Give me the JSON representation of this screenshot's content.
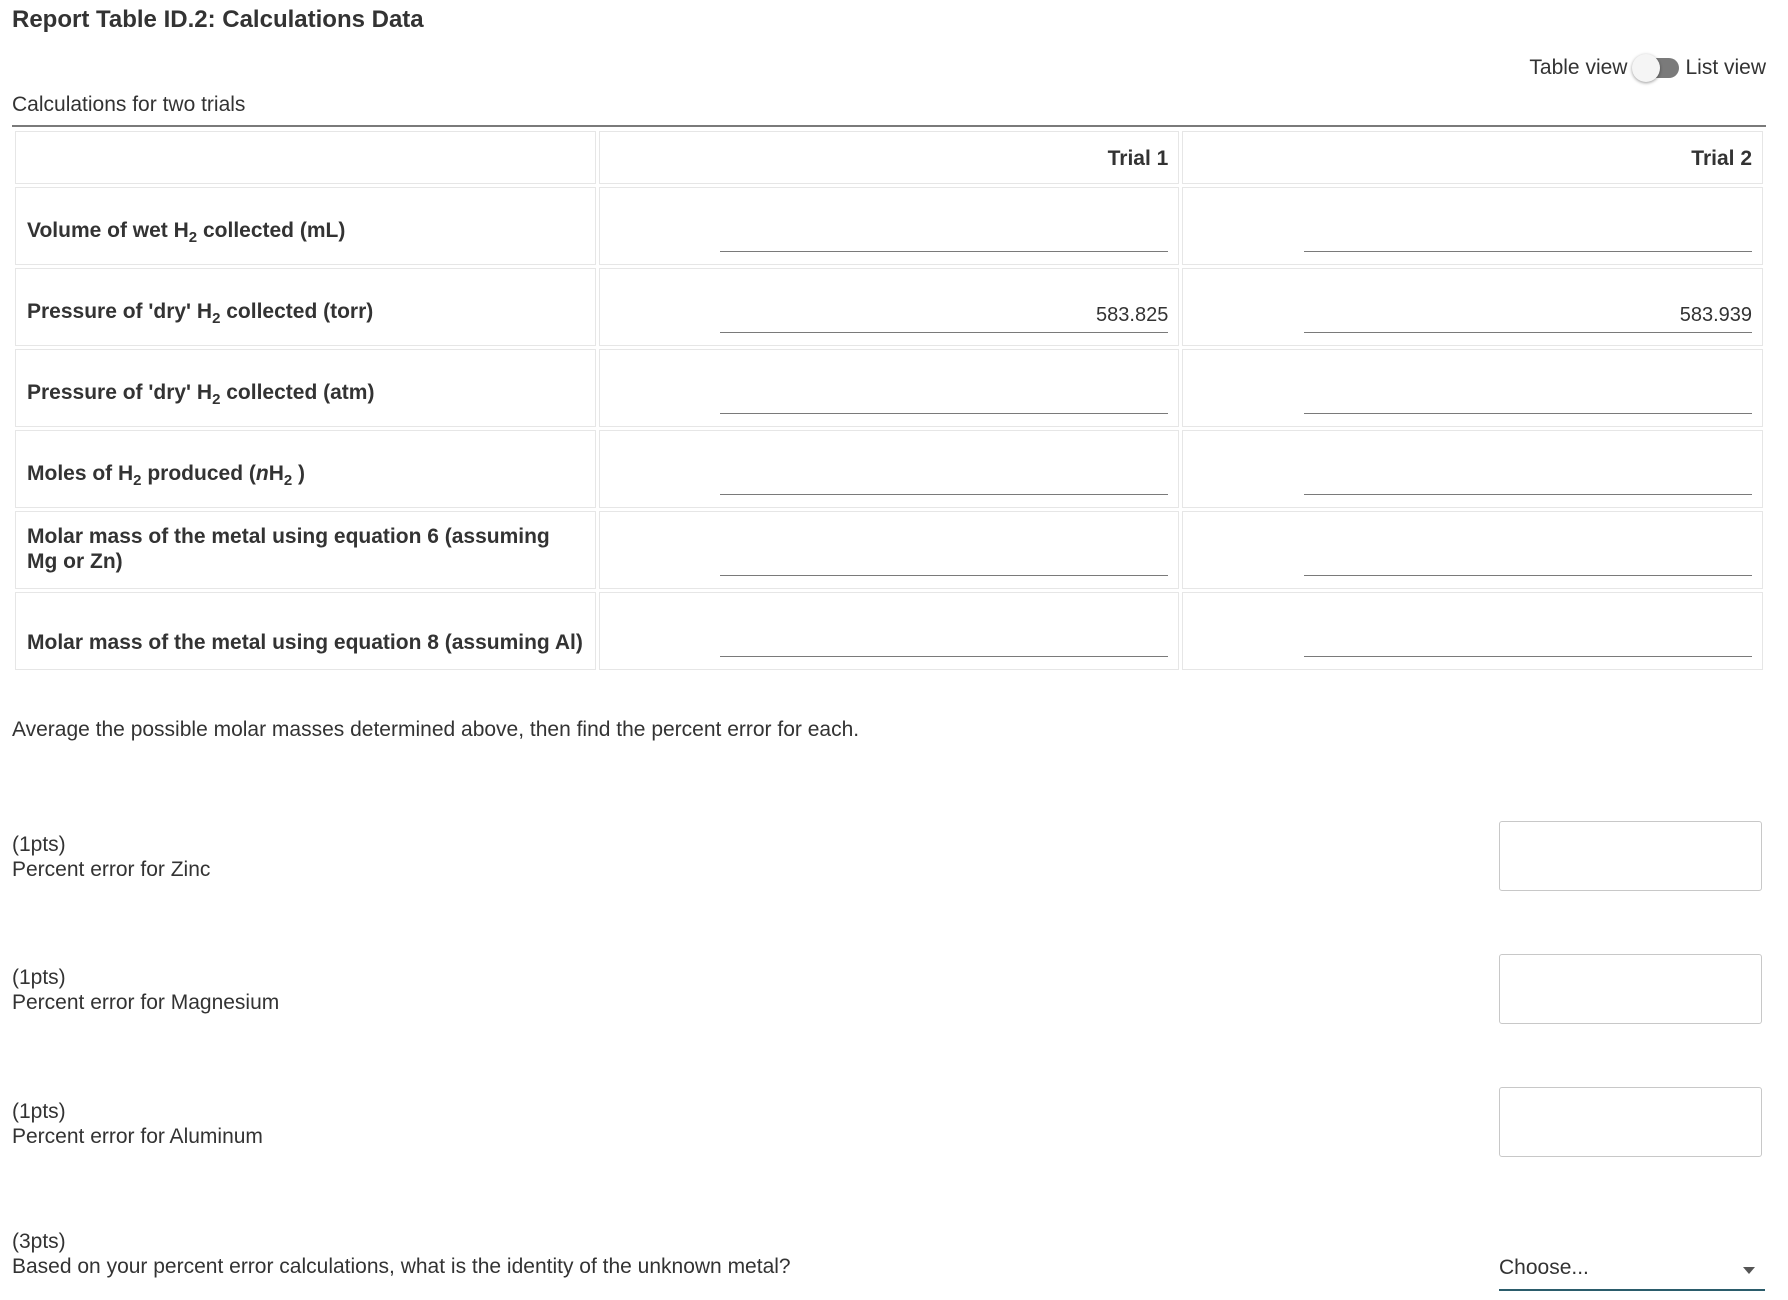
{
  "title": "Report Table ID.2: Calculations Data",
  "view_toggle": {
    "left_label": "Table view",
    "right_label": "List view"
  },
  "caption": "Calculations for two trials",
  "table": {
    "headers": [
      "Trial 1",
      "Trial 2"
    ],
    "rows": [
      {
        "label_parts": [
          "Volume of wet H",
          "2",
          " collected (mL)"
        ],
        "trial1": "",
        "trial2": ""
      },
      {
        "label_parts": [
          "Pressure of 'dry' H",
          "2",
          " collected (torr)"
        ],
        "trial1": "583.825",
        "trial2": "583.939"
      },
      {
        "label_parts": [
          "Pressure of 'dry' H",
          "2",
          " collected (atm)"
        ],
        "trial1": "",
        "trial2": ""
      },
      {
        "label_parts": [
          "Moles of H",
          "2",
          " produced (",
          "n",
          "H",
          "2",
          " )"
        ],
        "trial1": "",
        "trial2": ""
      },
      {
        "label_parts": [
          "Molar mass of the metal using equation 6 (assuming Mg or Zn)"
        ],
        "trial1": "",
        "trial2": ""
      },
      {
        "label_parts": [
          "Molar mass of the metal using equation 8 (assuming Al)"
        ],
        "trial1": "",
        "trial2": ""
      }
    ]
  },
  "instructions": "Average the possible molar masses determined above, then find the percent error for each.",
  "questions": [
    {
      "points": "(1pts)",
      "text": "Percent error for Zinc",
      "value": ""
    },
    {
      "points": "(1pts)",
      "text": "Percent error for Magnesium",
      "value": ""
    },
    {
      "points": "(1pts)",
      "text": "Percent error for Aluminum",
      "value": ""
    },
    {
      "points": "(3pts)",
      "text": "Based on your percent error calculations, what is the identity of the unknown metal?",
      "selected": "Choose..."
    }
  ],
  "colors": {
    "select_underline": "#2b5c6b",
    "toggle_track": "#7a7a7a"
  }
}
